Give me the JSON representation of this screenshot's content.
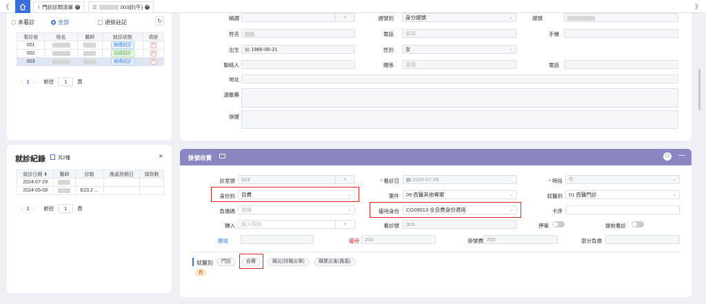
{
  "tabs": [
    {
      "label": "門診診間清單"
    },
    {
      "label": "003診(午)"
    }
  ],
  "left_patients": {
    "filters": [
      "未看診",
      "全部",
      "退掛註記"
    ],
    "headers": [
      "看診號",
      "姓名",
      "醫師",
      "就診狀態",
      "退掛"
    ],
    "rows": [
      {
        "no": "001",
        "status": "現場初診"
      },
      {
        "no": "002",
        "status": "完成初診"
      },
      {
        "no": "003",
        "status": "現場初診"
      }
    ],
    "pager": {
      "page": "1",
      "goto": "前往",
      "page_val": "1",
      "page_unit": "頁"
    }
  },
  "visits": {
    "title": "就診紀錄",
    "count": "共2種",
    "headers": [
      "就診日期",
      "醫師",
      "診斷",
      "應處到期日",
      "調劑數"
    ],
    "rows": [
      {
        "date": "2024-07-29",
        "diag": ""
      },
      {
        "date": "2024-05-08",
        "diag": "E23.2 ..."
      }
    ],
    "pager": {
      "page": "1",
      "goto": "前往",
      "page_val": "1",
      "page_unit": "頁"
    }
  },
  "patient": {
    "labels": {
      "title": "稱謂",
      "id_type": "證號別",
      "id_no": "證號",
      "name": "姓名",
      "phone": "電話",
      "mobile": "手機",
      "birth": "出生",
      "gender": "性別",
      "contact": "聯絡人",
      "relation": "關係",
      "contact_phone": "電話",
      "address": "地址",
      "allergy": "過敏藥",
      "remark": "保健"
    },
    "values": {
      "id_type": "身分證號",
      "birth": "1966-06-21",
      "gender": "女",
      "phone_ph": "選填",
      "relation_ph": "選填"
    }
  },
  "billing": {
    "title": "掛號收費",
    "labels": {
      "room": "診室號",
      "date": "看診日",
      "session": "時段",
      "identity": "身份別",
      "case": "案件",
      "dept": "就醫別",
      "copay_code": "負擔碼",
      "discount": "優待身份",
      "card_seq": "卡序",
      "transfer": "轉入",
      "visit_no": "看診號",
      "deposit": "押單",
      "skip": "提前看診",
      "receivable": "應收",
      "discount_amt": "優待",
      "reg_fee": "掛號費",
      "partial": "部分負擔"
    },
    "values": {
      "room": "003",
      "date": "2024-07-29",
      "session": "午",
      "identity": "自費",
      "case": "09 西醫其他專案",
      "dept": "01 西醫門診",
      "copay_code_ph": "選擇",
      "discount": "CG09013:全自費身份適用",
      "transfer_ph": "輸入院所",
      "visit_no": "003",
      "discount_amt": "200",
      "reg_fee": "200"
    },
    "category_label": "就醫別",
    "categories": [
      "門診",
      "自費",
      "職災(持職災單)",
      "職業災害(農義)"
    ],
    "tag": "異"
  },
  "colors": {
    "accent": "#3b6fd8",
    "header_purple": "#8a86c2",
    "red_box": "#e02020"
  }
}
